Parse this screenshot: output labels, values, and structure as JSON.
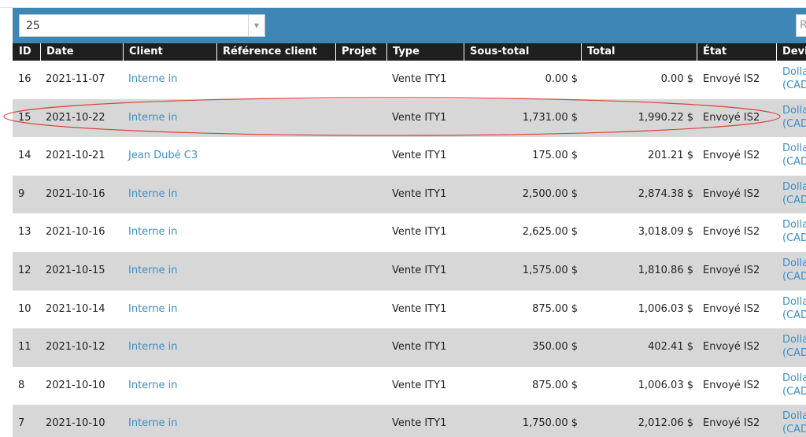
{
  "page_size": {
    "value": "25"
  },
  "search": {
    "visible_char": "R"
  },
  "columns": [
    "ID",
    "Date",
    "Client",
    "Référence client",
    "Projet",
    "Type",
    "Sous-total",
    "Total",
    "État",
    "Devi"
  ],
  "rows": [
    {
      "id": "16",
      "date": "2021-11-07",
      "client": "Interne in",
      "type": "Vente ITY1",
      "subtotal": "0.00 $",
      "total": "0.00 $",
      "state": "Envoyé IS2",
      "devise1": "Dolla",
      "devise2": "(CAD"
    },
    {
      "id": "15",
      "date": "2021-10-22",
      "client": "Interne in",
      "type": "Vente ITY1",
      "subtotal": "1,731.00 $",
      "total": "1,990.22 $",
      "state": "Envoyé IS2",
      "devise1": "Dolla",
      "devise2": "(CAD"
    },
    {
      "id": "14",
      "date": "2021-10-21",
      "client": "Jean Dubé C3",
      "type": "Vente ITY1",
      "subtotal": "175.00 $",
      "total": "201.21 $",
      "state": "Envoyé IS2",
      "devise1": "Dolla",
      "devise2": "(CAD"
    },
    {
      "id": "9",
      "date": "2021-10-16",
      "client": "Interne in",
      "type": "Vente ITY1",
      "subtotal": "2,500.00 $",
      "total": "2,874.38 $",
      "state": "Envoyé IS2",
      "devise1": "Dolla",
      "devise2": "(CAD"
    },
    {
      "id": "13",
      "date": "2021-10-16",
      "client": "Interne in",
      "type": "Vente ITY1",
      "subtotal": "2,625.00 $",
      "total": "3,018.09 $",
      "state": "Envoyé IS2",
      "devise1": "Dolla",
      "devise2": "(CAD"
    },
    {
      "id": "12",
      "date": "2021-10-15",
      "client": "Interne in",
      "type": "Vente ITY1",
      "subtotal": "1,575.00 $",
      "total": "1,810.86 $",
      "state": "Envoyé IS2",
      "devise1": "Dolla",
      "devise2": "(CAD"
    },
    {
      "id": "10",
      "date": "2021-10-14",
      "client": "Interne in",
      "type": "Vente ITY1",
      "subtotal": "875.00 $",
      "total": "1,006.03 $",
      "state": "Envoyé IS2",
      "devise1": "Dolla",
      "devise2": "(CAD"
    },
    {
      "id": "11",
      "date": "2021-10-12",
      "client": "Interne in",
      "type": "Vente ITY1",
      "subtotal": "350.00 $",
      "total": "402.41 $",
      "state": "Envoyé IS2",
      "devise1": "Dolla",
      "devise2": "(CAD"
    },
    {
      "id": "8",
      "date": "2021-10-10",
      "client": "Interne in",
      "type": "Vente ITY1",
      "subtotal": "875.00 $",
      "total": "1,006.03 $",
      "state": "Envoyé IS2",
      "devise1": "Dolla",
      "devise2": "(CAD"
    },
    {
      "id": "7",
      "date": "2021-10-10",
      "client": "Interne in",
      "type": "Vente ITY1",
      "subtotal": "1,750.00 $",
      "total": "2,012.06 $",
      "state": "Envoyé IS2",
      "devise1": "Dolla",
      "devise2": "(CAD"
    }
  ],
  "colors": {
    "toolbar": "#3d86b5",
    "header": "#1f1f1f",
    "stripe": "#d7d7d7",
    "link": "#3d8fc4",
    "highlight": "#d9443a"
  }
}
